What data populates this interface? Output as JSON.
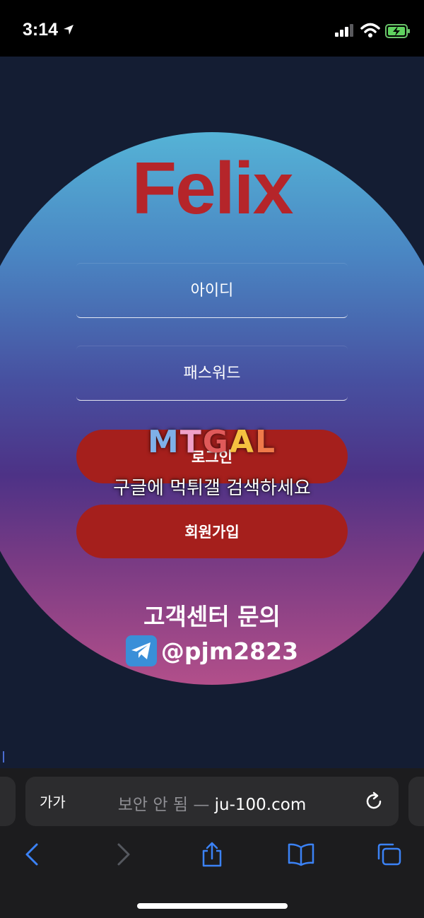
{
  "status_bar": {
    "time": "3:14"
  },
  "login": {
    "logo": "Felix",
    "id_placeholder": "아이디",
    "password_placeholder": "패스워드",
    "login_label": "로그인",
    "signup_label": "회원가입"
  },
  "watermark": {
    "logo_letters": [
      "M",
      "T",
      "G",
      "A",
      "L"
    ],
    "logo_colors": [
      "#7fb0e8",
      "#f0a0c8",
      "#e05a5a",
      "#f5c040",
      "#f07a4a"
    ],
    "text": "구글에 먹튀갤 검색하세요"
  },
  "support": {
    "title": "고객센터 문의",
    "handle": "@pjm2823"
  },
  "browser": {
    "aa_label": "가가",
    "security": "보안 안 됨 — ",
    "host": "ju-100.com"
  },
  "colors": {
    "accent_red": "#b5252a",
    "button_red": "#a51f1c",
    "safari_blue": "#3b82f6"
  }
}
